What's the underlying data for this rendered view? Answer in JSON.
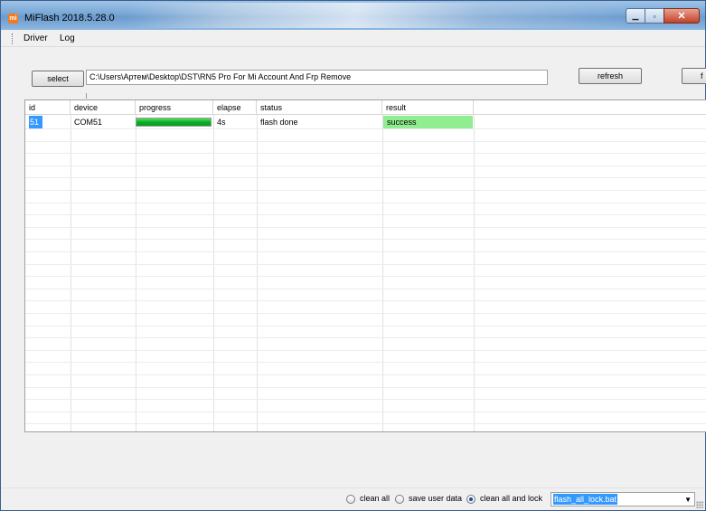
{
  "window": {
    "title": "MiFlash 2018.5.28.0",
    "icon_letter": "mi"
  },
  "menu": {
    "items": [
      "Driver",
      "Log"
    ]
  },
  "toolbar": {
    "select_label": "select",
    "path_value": "C:\\Users\\Артем\\Desktop\\DST\\RN5 Pro For Mi Account And Frp Remove",
    "refresh_label": "refresh",
    "flash_label": "f"
  },
  "grid": {
    "columns": [
      "id",
      "device",
      "progress",
      "elapse",
      "status",
      "result"
    ],
    "rows": [
      {
        "id": "51",
        "device": "COM51",
        "progress_pct": 100,
        "elapse": "4s",
        "status": "flash done",
        "result": "success"
      }
    ]
  },
  "statusbar": {
    "options": [
      "clean all",
      "save user data",
      "clean all and lock"
    ],
    "selected_option": "clean all and lock",
    "script_value": "flash_all_lock.bat"
  },
  "colors": {
    "success": "#90ee90",
    "selection": "#3399ff",
    "progress": "#06b025"
  }
}
